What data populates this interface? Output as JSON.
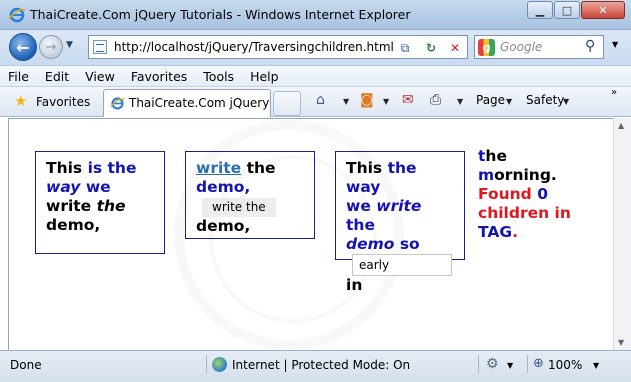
{
  "window": {
    "title": "ThaiCreate.Com jQuery Tutorials - Windows Internet Explorer",
    "minimize": "▁",
    "maximize": "□",
    "close": "✕"
  },
  "address": {
    "url": "http://localhost/jQuery/Traversingchildren.html",
    "search_placeholder": "Google"
  },
  "menu": [
    "File",
    "Edit",
    "View",
    "Favorites",
    "Tools",
    "Help"
  ],
  "favbar": {
    "favorites_label": "Favorites",
    "tab_title": "ThaiCreate.Com jQuery ...",
    "page_label": "Page",
    "safety_label": "Safety"
  },
  "content": {
    "box1": {
      "t1": "This",
      "t2": "is the",
      "t3": "way",
      "t4": "we",
      "t5": "write",
      "t6": "the",
      "t7": "demo,"
    },
    "box2": {
      "link": "write",
      "t1": "the",
      "t2": "demo,",
      "pill": "write the",
      "t3": "demo,"
    },
    "box3": {
      "t1": "This",
      "t2": "the way",
      "t3": "we",
      "t4": "write",
      "t5": "the",
      "t6": "demo",
      "t7": "so",
      "input": "early",
      "t8": "in"
    },
    "col4": {
      "l1a": "t",
      "l1b": "he",
      "l2a": "m",
      "l2b": "orning.",
      "l3": "Found",
      "l3n": "0",
      "l4": "children in",
      "l5": "TAG",
      "l5dot": "."
    }
  },
  "status": {
    "left": "Done",
    "zone": "Internet | Protected Mode: On",
    "zoom": "100%"
  },
  "colors": {
    "blue_text": "#1414b4",
    "red_text": "#e0181e",
    "box_border": "#1b1b9c"
  }
}
